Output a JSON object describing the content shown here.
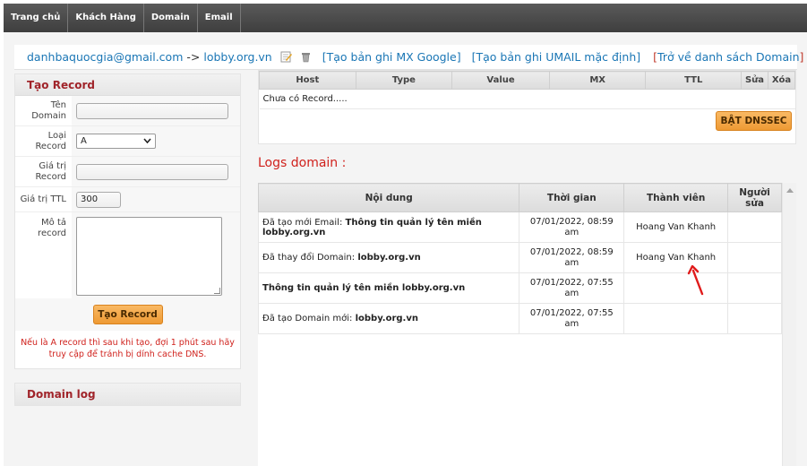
{
  "nav": {
    "items": [
      "Trang chủ",
      "Khách Hàng",
      "Domain",
      "Email"
    ]
  },
  "domainbar": {
    "email": "danhbaquocgia@gmail.com",
    "arrow": "->",
    "domain": "lobby.org.vn",
    "edit_icon": "edit-icon",
    "delete_icon": "trash-icon",
    "link_mx_google": "[Tạo bản ghi MX Google]",
    "link_umail": "[Tạo bản ghi UMAIL mặc định]",
    "link_back_open": "[",
    "link_back": "Trở về danh sách Domain",
    "link_back_close": "]"
  },
  "form": {
    "title": "Tạo Record",
    "name_label": "Tên Domain",
    "type_label": "Loại Record",
    "type_value": "A",
    "value_label": "Giá trị Record",
    "ttl_label": "Giá trị TTL",
    "ttl_value": "300",
    "desc_label": "Mô tả record",
    "submit": "Tạo Record",
    "note": "Nếu là A record thì sau khi tạo, đợi 1 phút sau hãy truy cập để tránh bị dính cache DNS."
  },
  "domain_log_title": "Domain log",
  "records": {
    "columns": [
      "Host",
      "Type",
      "Value",
      "MX",
      "TTL",
      "Sửa",
      "Xóa"
    ],
    "empty": "Chưa có Record.....",
    "dnssec_button": "BẬT DNSSEC"
  },
  "logs": {
    "title": "Logs domain :",
    "columns": [
      "Nội dung",
      "Thời gian",
      "Thành viên",
      "Người sửa"
    ],
    "rows": [
      {
        "prefix": "Đã tạo mới Email: ",
        "bold": "Thông tin quản lý tên miền lobby.org.vn",
        "time": "07/01/2022, 08:59 am",
        "member": "Hoang Van Khanh",
        "editor": ""
      },
      {
        "prefix": "Đã thay đổi Domain: ",
        "bold": "lobby.org.vn",
        "time": "07/01/2022, 08:59 am",
        "member": "Hoang Van Khanh",
        "editor": ""
      },
      {
        "prefix": "",
        "bold": "Thông tin quản lý tên miền lobby.org.vn",
        "time": "07/01/2022, 07:55 am",
        "member": "",
        "editor": ""
      },
      {
        "prefix": "Đã tạo Domain mới: ",
        "bold": "lobby.org.vn",
        "time": "07/01/2022, 07:55 am",
        "member": "",
        "editor": ""
      }
    ]
  },
  "colors": {
    "accent_red": "#d0211c",
    "link_blue": "#1a76b5",
    "button_orange": "#f0a040",
    "nav_dark": "#464646"
  }
}
